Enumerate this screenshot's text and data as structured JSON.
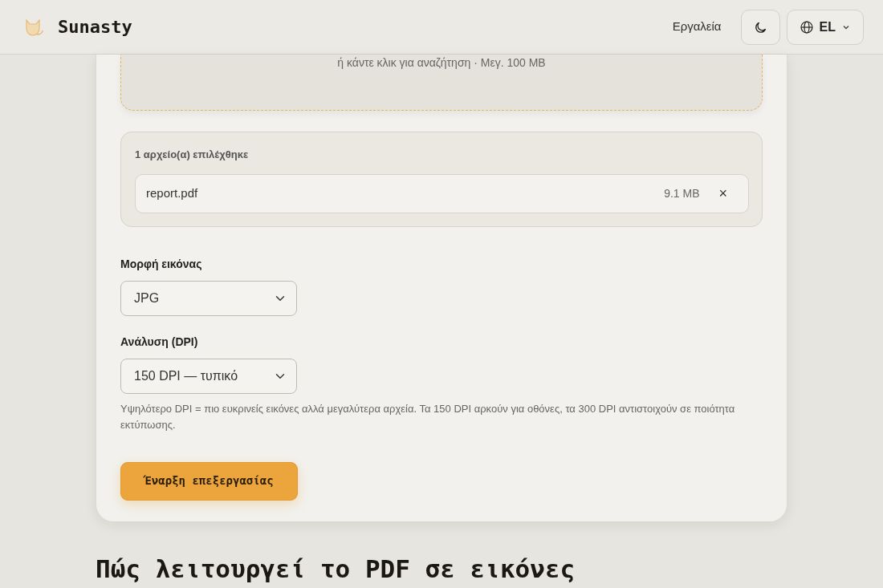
{
  "header": {
    "brand": "Sunasty",
    "nav_link": "Εργαλεία",
    "language": "EL"
  },
  "dropzone": {
    "hint": "ή κάντε κλικ για αναζήτηση · Μεγ. 100 MB"
  },
  "selected_files": {
    "count_label": "1 αρχείο(α) επιλέχθηκε",
    "files": [
      {
        "name": "report.pdf",
        "size": "9.1 MB",
        "remove": "×"
      }
    ]
  },
  "format": {
    "label": "Μορφή εικόνας",
    "value": "JPG"
  },
  "resolution": {
    "label": "Ανάλυση (DPI)",
    "value": "150 DPI — τυπικό",
    "help": "Υψηλότερο DPI = πιο ευκρινείς εικόνες αλλά μεγαλύτερα αρχεία. Τα 150 DPI αρκούν για οθόνες, τα 300 DPI αντιστοιχούν σε ποιότητα εκτύπωσης."
  },
  "start_button": "Έναρξη επεξεργασίας",
  "section_heading": "Πώς λειτουργεί το PDF σε εικόνες"
}
